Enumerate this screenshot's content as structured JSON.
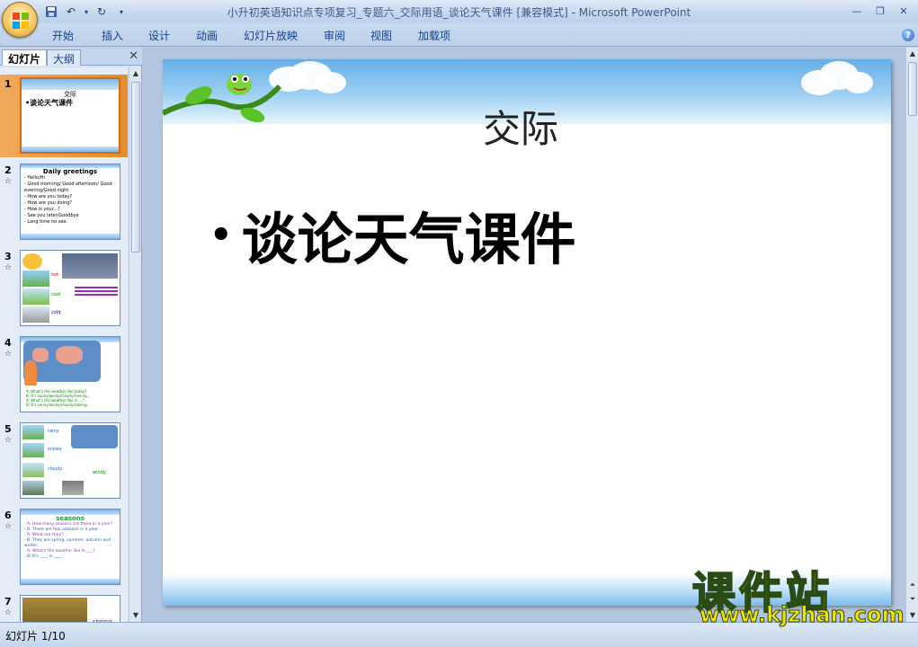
{
  "window": {
    "title": "小升初英语知识点专项复习_专题六_交际用语_谈论天气课件 [兼容模式] - Microsoft PowerPoint"
  },
  "ribbon": {
    "tabs": [
      "开始",
      "插入",
      "设计",
      "动画",
      "幻灯片放映",
      "审阅",
      "视图",
      "加载项"
    ]
  },
  "pane": {
    "tab_slides": "幻灯片",
    "tab_outline": "大纲",
    "thumbnails": [
      {
        "num": "1",
        "title": "交际",
        "lines": [
          "•谈论天气课件"
        ]
      },
      {
        "num": "2",
        "title": "Daily greetings",
        "lines": [
          "- Hello/Hi",
          "- Good morning/ Good afternoon/ Good",
          "  evening/Good night",
          "- How are you today?",
          "- How are you doing?",
          "- How is your...?",
          "- See you later/Goodbye",
          "- Long time no see."
        ]
      },
      {
        "num": "3",
        "title": "",
        "lines": [
          "hot",
          "cool",
          "cold"
        ]
      },
      {
        "num": "4",
        "title": "",
        "lines": [
          "A: What's the weather like today?",
          "B: It's sunny/windy/cloudy/raining...",
          "A: What's the weather like in ...?",
          "B: It's sunny/windy/cloudy/raining..."
        ]
      },
      {
        "num": "5",
        "title": "",
        "lines": [
          "rainy",
          "snowy",
          "cloudy",
          "windy"
        ]
      },
      {
        "num": "6",
        "title": "seasons",
        "lines": [
          "- A: How many seasons are there in a year?",
          "- B: There are four seasons in a year.",
          "- A: What are they?",
          "- B: They are spring, summer, autumn and",
          "  winter.",
          "- A: What's the weather like in ___?",
          "- B: It's ____ in ____."
        ]
      },
      {
        "num": "7",
        "title": "",
        "lines": [
          "spring"
        ]
      }
    ]
  },
  "slide": {
    "title": "交际",
    "bullet": "谈论天气课件"
  },
  "status": {
    "slide_counter": "幻灯片 1/10"
  },
  "watermark": {
    "cn": "课件站",
    "url": "www.kjzhan.com"
  },
  "colors": {
    "ribbon_bg": "#bcd0ea",
    "selected_thumb": "#e38b2f",
    "watermark_yellow": "#f5e200"
  }
}
